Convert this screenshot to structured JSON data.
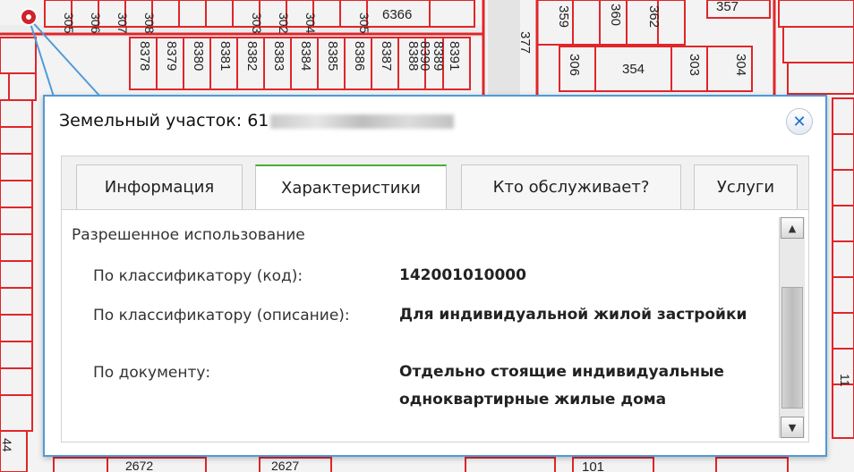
{
  "map": {
    "top_row_labels": [
      "305",
      "306",
      "307",
      "308",
      "303",
      "302",
      "304",
      "305"
    ],
    "top_row_number": "6366",
    "column_labels": [
      "8378",
      "8379",
      "8380",
      "8381",
      "8382",
      "8383",
      "8384",
      "8385",
      "8386",
      "8387",
      "8388",
      "8389",
      "8390"
    ],
    "label_8391": "8391",
    "label_377": "377",
    "label_359": "359",
    "label_360": "360",
    "label_362": "362",
    "label_357": "357",
    "label_306b": "306",
    "label_354": "354",
    "label_303": "303",
    "label_304": "304",
    "label_44": "44",
    "label_bottom_1": "2672",
    "label_bottom_2": "2627",
    "label_bottom_3": "101",
    "label_11": "11",
    "marker_color": "#d0232a",
    "boundary_color": "#e0262a"
  },
  "popup": {
    "title": "Земельный участок: 61",
    "close_symbol": "✕",
    "tabs": [
      {
        "label": "Информация",
        "active": false
      },
      {
        "label": "Характеристики",
        "active": true
      },
      {
        "label": "Кто обслуживает?",
        "active": false
      },
      {
        "label": "Услуги",
        "active": false
      }
    ],
    "accent_color": "#48ad33",
    "border_color": "#4f9ad8"
  },
  "characteristics": {
    "section_heading": "Разрешенное использование",
    "rows": [
      {
        "label": "По классификатору (код):",
        "value": "142001010000"
      },
      {
        "label": "По классификатору (описание):",
        "value": "Для индивидуальной жилой застройки"
      },
      {
        "label": "По документу:",
        "value": "Отдельно стоящие индивидуальные одноквартирные жилые дома"
      }
    ]
  },
  "scrollbar": {
    "up_symbol": "▲",
    "down_symbol": "▼"
  }
}
